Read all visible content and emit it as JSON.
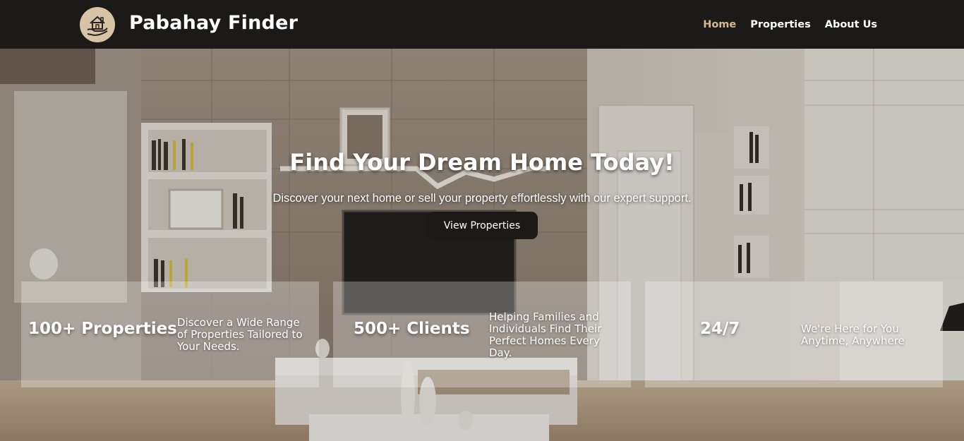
{
  "brand": {
    "name": "Pabahay Finder",
    "logo_icon": "house-in-hand-icon"
  },
  "nav": {
    "items": [
      {
        "label": "Home",
        "active": true
      },
      {
        "label": "Properties",
        "active": false
      },
      {
        "label": "About Us",
        "active": false
      }
    ]
  },
  "hero": {
    "title": "Find Your Dream Home Today!",
    "subtitle": "Discover your next home or sell your property effortlessly with our expert support.",
    "cta_label": "View Properties"
  },
  "stats": [
    {
      "value": "100+ Properties",
      "description": "Discover a Wide Range of Properties Tailored to Your Needs."
    },
    {
      "value": "500+ Clients",
      "description": "Helping Families and Individuals Find Their Perfect Homes Every Day."
    },
    {
      "value": "24/7",
      "description": "We're Here for You Anytime, Anywhere"
    }
  ],
  "colors": {
    "navbar": "#1b1a19",
    "accent": "#d8b98f",
    "logo_bg": "#d9c3a7"
  }
}
